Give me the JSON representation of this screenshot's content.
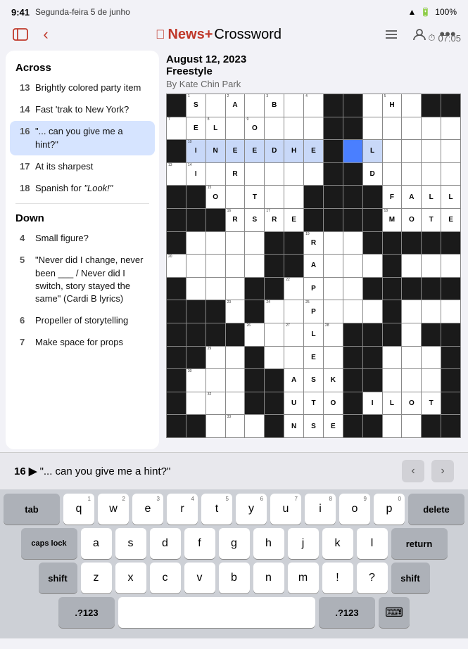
{
  "statusBar": {
    "time": "9:41",
    "date": "Segunda-feira 5 de junho",
    "battery": "100%",
    "wifi": "WiFi"
  },
  "navBar": {
    "title": "Crossword",
    "newsPlus": "News+",
    "icons": [
      "sidebar",
      "back",
      "list",
      "person",
      "more"
    ]
  },
  "puzzle": {
    "date": "August 12, 2023",
    "type": "Freestyle",
    "author": "By Kate Chin Park",
    "timer": "07:05"
  },
  "clues": {
    "acrossTitle": "Across",
    "downTitle": "Down",
    "across": [
      {
        "num": "13",
        "text": "Brightly colored party item"
      },
      {
        "num": "14",
        "text": "Fast 'trak to New York?"
      },
      {
        "num": "16",
        "text": "\"... can you give me a hint?\"",
        "active": true
      },
      {
        "num": "17",
        "text": "At its sharpest"
      },
      {
        "num": "18",
        "text": "Spanish for \"Look!\""
      }
    ],
    "down": [
      {
        "num": "4",
        "text": "Small figure?"
      },
      {
        "num": "5",
        "text": "\"Never did I change, never been ___ / Never did I switch, story stayed the same\" (Cardi B lyrics)"
      },
      {
        "num": "6",
        "text": "Propeller of storytelling"
      },
      {
        "num": "7",
        "text": "Make space for props"
      }
    ]
  },
  "bottomClue": {
    "number": "16",
    "direction": "▶",
    "text": "\"... can you give me a hint?\""
  },
  "keyboard": {
    "row1": [
      {
        "label": "q",
        "num": "1"
      },
      {
        "label": "w",
        "num": "2"
      },
      {
        "label": "e",
        "num": "3"
      },
      {
        "label": "r",
        "num": "4"
      },
      {
        "label": "t",
        "num": "5"
      },
      {
        "label": "y",
        "num": "6"
      },
      {
        "label": "u",
        "num": "7"
      },
      {
        "label": "i",
        "num": "8"
      },
      {
        "label": "o",
        "num": "9"
      },
      {
        "label": "p",
        "num": "0"
      }
    ],
    "row2": [
      {
        "label": "a"
      },
      {
        "label": "s"
      },
      {
        "label": "d"
      },
      {
        "label": "f"
      },
      {
        "label": "g"
      },
      {
        "label": "h"
      },
      {
        "label": "j"
      },
      {
        "label": "k"
      },
      {
        "label": "l"
      }
    ],
    "row3Letters": [
      {
        "label": "z"
      },
      {
        "label": "x"
      },
      {
        "label": "c"
      },
      {
        "label": "v"
      },
      {
        "label": "b"
      },
      {
        "label": "n"
      },
      {
        "label": "m"
      },
      {
        "label": "!"
      },
      {
        "label": "?"
      }
    ],
    "specialKeys": {
      "tab": "tab",
      "capsLock": "caps lock",
      "shift": "shift",
      "numbers": ".?123",
      "delete": "delete",
      "return": "return",
      "emoji": "⌨"
    }
  },
  "grid": {
    "cols": 15,
    "rows": 15
  }
}
